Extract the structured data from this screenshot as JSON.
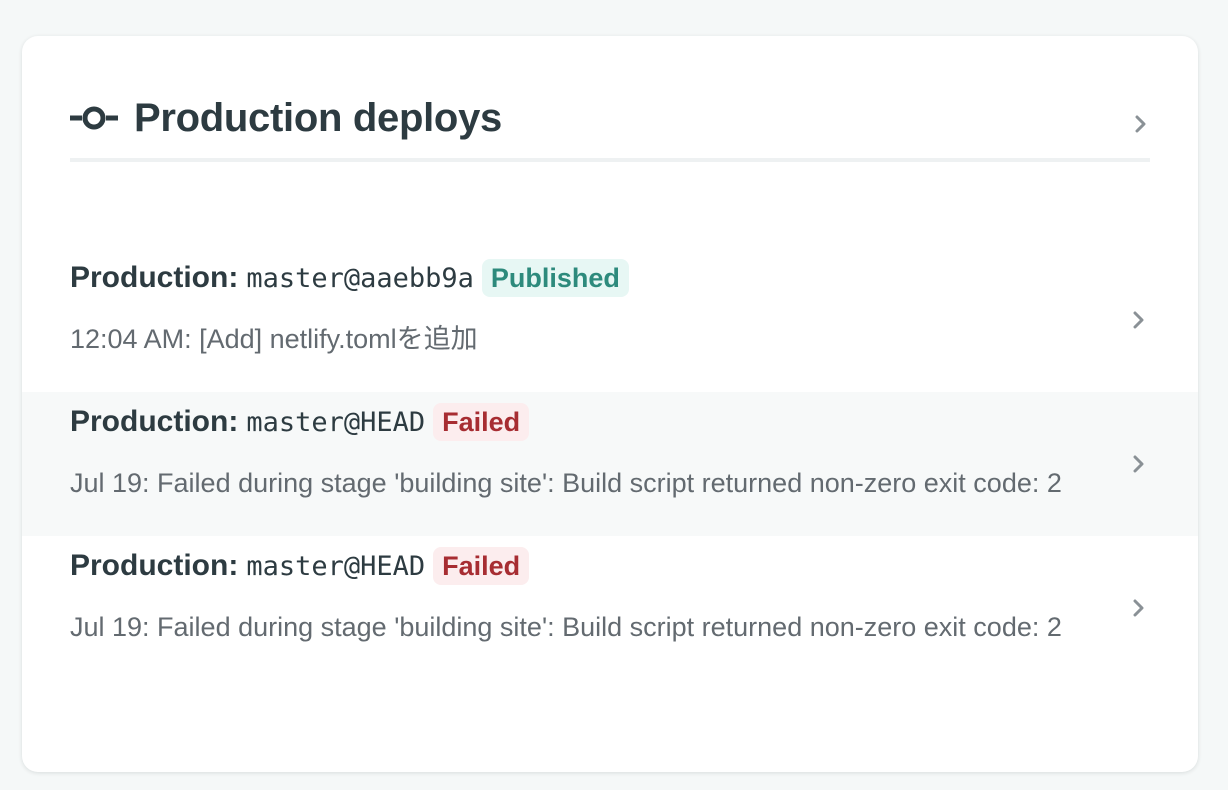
{
  "header": {
    "title": "Production deploys"
  },
  "deploys": [
    {
      "context": "Production:",
      "ref": "master@aaebb9a",
      "status": "Published",
      "status_kind": "published",
      "description": "12:04 AM: [Add] netlify.tomlを追加"
    },
    {
      "context": "Production:",
      "ref": "master@HEAD",
      "status": "Failed",
      "status_kind": "failed",
      "description": "Jul 19: Failed during stage 'building site': Build script returned non-zero exit code: 2"
    },
    {
      "context": "Production:",
      "ref": "master@HEAD",
      "status": "Failed",
      "status_kind": "failed",
      "description": "Jul 19: Failed during stage 'building site': Build script returned non-zero exit code: 2"
    }
  ],
  "colors": {
    "title": "#2d3b41",
    "published": "#2d8a7c",
    "failed": "#a72d32",
    "muted": "#636a70"
  },
  "icons": {
    "header": "git-commit-icon",
    "row": "chevron-right-icon"
  }
}
